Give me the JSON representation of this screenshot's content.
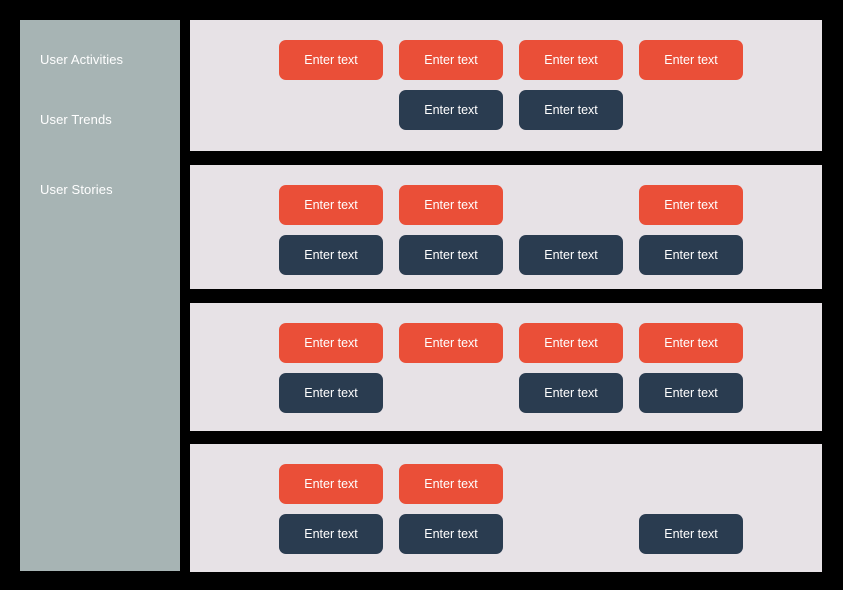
{
  "theme": {
    "page_background": "#000000",
    "sidebar_background": "#A7B4B4",
    "panel_background": "#E7E2E6",
    "button_primary_color": "#EA4F38",
    "button_secondary_color": "#2A3C50",
    "text_on_dark": "#FFFFFF"
  },
  "sidebar": {
    "items": [
      {
        "label": "User Activities"
      },
      {
        "label": "User Trends"
      },
      {
        "label": "User Stories"
      }
    ]
  },
  "button_label": "Enter text",
  "panels": [
    {
      "name": "panel-1",
      "rows": [
        {
          "buttons": [
            {
              "label": "Enter text",
              "variant": "red",
              "column": 1
            },
            {
              "label": "Enter text",
              "variant": "red",
              "column": 2
            },
            {
              "label": "Enter text",
              "variant": "red",
              "column": 3
            },
            {
              "label": "Enter text",
              "variant": "red",
              "column": 4
            }
          ]
        },
        {
          "buttons": [
            {
              "label": "Enter text",
              "variant": "navy",
              "column": 2
            },
            {
              "label": "Enter text",
              "variant": "navy",
              "column": 3
            }
          ]
        }
      ]
    },
    {
      "name": "panel-2",
      "rows": [
        {
          "buttons": [
            {
              "label": "Enter text",
              "variant": "red",
              "column": 1
            },
            {
              "label": "Enter text",
              "variant": "red",
              "column": 2
            },
            {
              "label": "Enter text",
              "variant": "red",
              "column": 4
            }
          ]
        },
        {
          "buttons": [
            {
              "label": "Enter text",
              "variant": "navy",
              "column": 1
            },
            {
              "label": "Enter text",
              "variant": "navy",
              "column": 2
            },
            {
              "label": "Enter text",
              "variant": "navy",
              "column": 3
            },
            {
              "label": "Enter text",
              "variant": "navy",
              "column": 4
            }
          ]
        }
      ]
    },
    {
      "name": "panel-3",
      "rows": [
        {
          "buttons": [
            {
              "label": "Enter text",
              "variant": "red",
              "column": 1
            },
            {
              "label": "Enter text",
              "variant": "red",
              "column": 2
            },
            {
              "label": "Enter text",
              "variant": "red",
              "column": 3
            },
            {
              "label": "Enter text",
              "variant": "red",
              "column": 4
            }
          ]
        },
        {
          "buttons": [
            {
              "label": "Enter text",
              "variant": "navy",
              "column": 1
            },
            {
              "label": "Enter text",
              "variant": "navy",
              "column": 3
            },
            {
              "label": "Enter text",
              "variant": "navy",
              "column": 4
            }
          ]
        }
      ]
    },
    {
      "name": "panel-4",
      "rows": [
        {
          "buttons": [
            {
              "label": "Enter text",
              "variant": "red",
              "column": 1
            },
            {
              "label": "Enter text",
              "variant": "red",
              "column": 2
            }
          ]
        },
        {
          "buttons": [
            {
              "label": "Enter text",
              "variant": "navy",
              "column": 1
            },
            {
              "label": "Enter text",
              "variant": "navy",
              "column": 2
            },
            {
              "label": "Enter text",
              "variant": "navy",
              "column": 3.5
            }
          ]
        }
      ]
    }
  ]
}
